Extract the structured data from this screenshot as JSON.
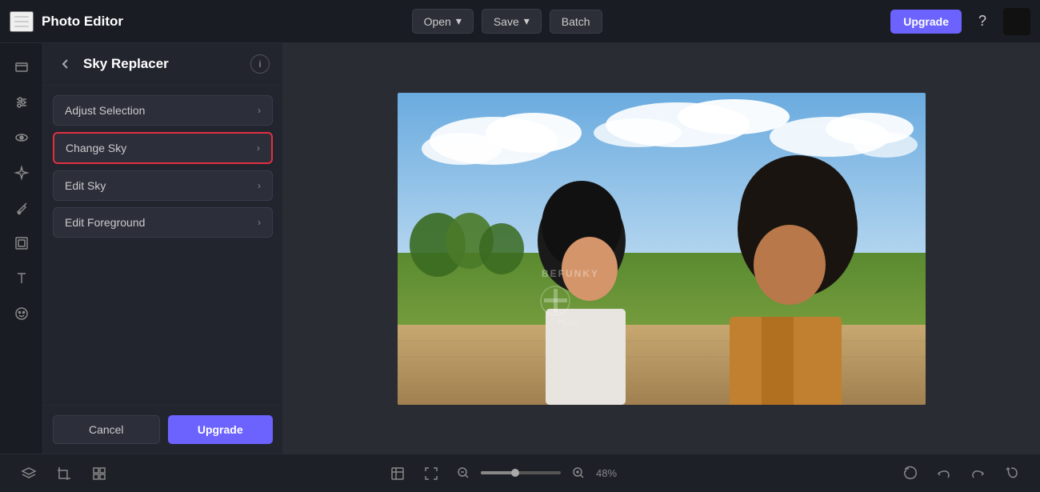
{
  "app": {
    "title": "Photo Editor"
  },
  "topbar": {
    "open_label": "Open",
    "save_label": "Save",
    "batch_label": "Batch",
    "upgrade_label": "Upgrade",
    "help_label": "?"
  },
  "panel": {
    "back_label": "←",
    "title": "Sky Replacer",
    "info_label": "i",
    "menu_items": [
      {
        "label": "Adjust Selection",
        "active": false
      },
      {
        "label": "Change Sky",
        "active": true
      },
      {
        "label": "Edit Sky",
        "active": false
      },
      {
        "label": "Edit Foreground",
        "active": false
      }
    ],
    "cancel_label": "Cancel",
    "upgrade_label": "Upgrade"
  },
  "bottombar": {
    "zoom_percent": "48%"
  },
  "icons": {
    "hamburger": "≡",
    "layers": "⊞",
    "adjustments": "⊟",
    "eye": "👁",
    "sparkle": "✦",
    "brush": "✏",
    "frames": "▦",
    "text": "T",
    "sticker": "☺",
    "chevron_right": "›",
    "stack": "⊕",
    "fit": "⊡",
    "grid": "⊞",
    "fit_screen": "⛶",
    "zoom_in": "+",
    "zoom_out": "−",
    "undo_history": "↺",
    "undo": "↩",
    "redo": "↪",
    "reset": "↺"
  }
}
